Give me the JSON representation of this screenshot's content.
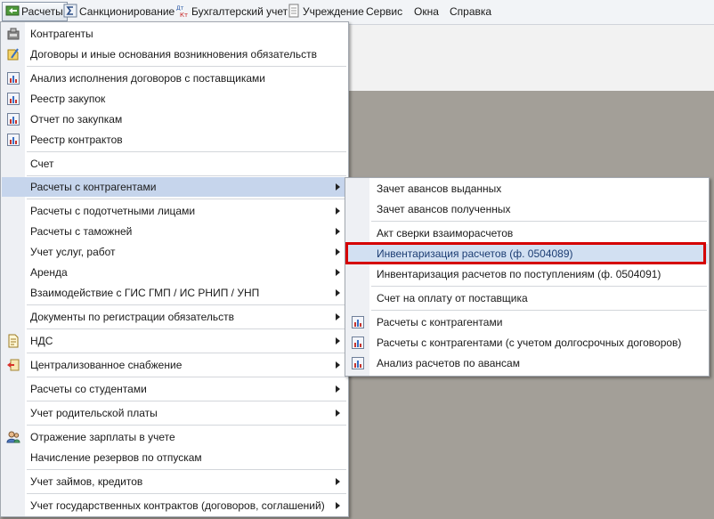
{
  "menubar": {
    "items": [
      {
        "label": "Расчеты"
      },
      {
        "label": "Санкционирование"
      },
      {
        "label": "Бухгалтерский учет"
      },
      {
        "label": "Учреждение"
      },
      {
        "label": "Сервис"
      },
      {
        "label": "Окна"
      },
      {
        "label": "Справка"
      }
    ]
  },
  "main_menu": {
    "items": [
      {
        "label": "Контрагенты",
        "icon": "contractors-icon"
      },
      {
        "label": "Договоры и иные основания возникновения обязательств",
        "icon": "contracts-icon"
      },
      {
        "label": "Анализ исполнения договоров с поставщиками",
        "icon": "report-icon"
      },
      {
        "label": "Реестр закупок",
        "icon": "report-icon"
      },
      {
        "label": "Отчет по закупкам",
        "icon": "report-icon"
      },
      {
        "label": "Реестр контрактов",
        "icon": "report-icon"
      },
      {
        "label": "Счет"
      },
      {
        "label": "Расчеты с контрагентами",
        "submenu": true
      },
      {
        "label": "Расчеты с подотчетными лицами",
        "submenu": true
      },
      {
        "label": "Расчеты с таможней",
        "submenu": true
      },
      {
        "label": "Учет услуг, работ",
        "submenu": true
      },
      {
        "label": "Аренда",
        "submenu": true
      },
      {
        "label": "Взаимодействие с ГИС ГМП / ИС РНИП / УНП",
        "submenu": true
      },
      {
        "label": "Документы по регистрации обязательств",
        "submenu": true
      },
      {
        "label": "НДС",
        "submenu": true,
        "icon": "vat-document-icon"
      },
      {
        "label": "Централизованное снабжение",
        "submenu": true,
        "icon": "supply-icon"
      },
      {
        "label": "Расчеты со студентами",
        "submenu": true
      },
      {
        "label": "Учет родительской платы",
        "submenu": true
      },
      {
        "label": "Отражение зарплаты в учете",
        "icon": "users-icon"
      },
      {
        "label": "Начисление резервов по отпускам"
      },
      {
        "label": "Учет займов, кредитов",
        "submenu": true
      },
      {
        "label": "Учет государственных контрактов (договоров, соглашений)",
        "submenu": true
      }
    ]
  },
  "submenu": {
    "items": [
      {
        "label": "Зачет авансов выданных"
      },
      {
        "label": "Зачет авансов полученных"
      },
      {
        "label": "Акт сверки взаиморасчетов"
      },
      {
        "label": "Инвентаризация расчетов (ф. 0504089)"
      },
      {
        "label": "Инвентаризация расчетов по поступлениям (ф. 0504091)"
      },
      {
        "label": "Счет на оплату от поставщика"
      },
      {
        "label": "Расчеты с контрагентами",
        "icon": "report-icon"
      },
      {
        "label": "Расчеты с контрагентами (с учетом долгосрочных договоров)",
        "icon": "report-icon"
      },
      {
        "label": "Анализ расчетов по авансам",
        "icon": "report-icon"
      }
    ]
  },
  "colors": {
    "highlight_frame": "#d50000",
    "hover_background": "#c6d5ec",
    "workspace": "#a39f98"
  }
}
